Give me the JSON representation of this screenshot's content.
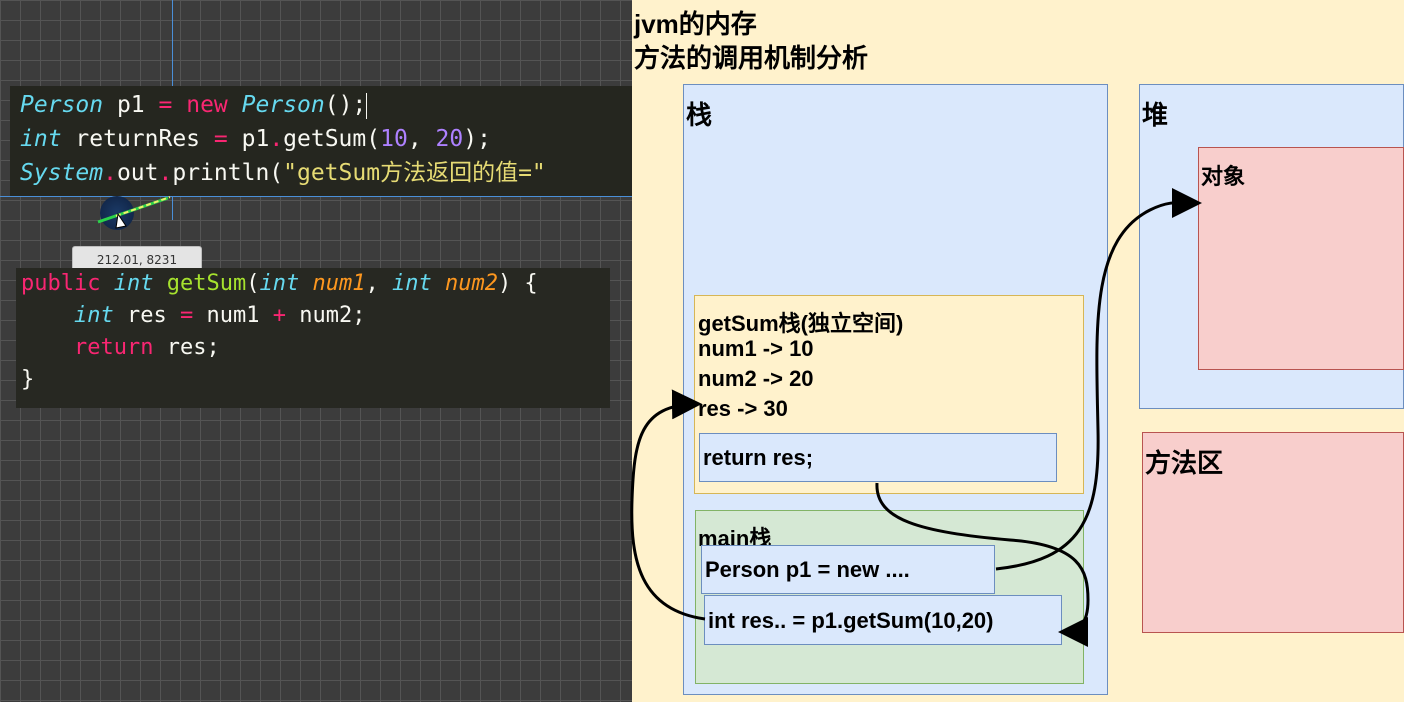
{
  "code1": {
    "line1": {
      "type": "Person",
      "var": "p1",
      "op": "=",
      "kw": "new",
      "ctor": "Person",
      "tail": "();"
    },
    "line2": {
      "type": "int",
      "var": "returnRes",
      "op": "=",
      "obj": "p1",
      "call": "getSum(",
      "n1": "10",
      "sep": ", ",
      "n2": "20",
      "tail": ");"
    },
    "line3": {
      "cls": "System",
      "field": "out",
      "call": "println(",
      "str": "\"getSum方法返回的值=\""
    }
  },
  "code2": {
    "line1": {
      "kw": "public",
      "type": "int",
      "fn": "getSum",
      "open": "(",
      "t1": "int",
      "p1": "num1",
      "sep": ", ",
      "t2": "int",
      "p2": "num2",
      "close": ") {"
    },
    "line2": {
      "type": "int",
      "var": "res",
      "op": "=",
      "a": "num1",
      "plus": "+",
      "b": "num2;"
    },
    "line3": {
      "kw": "return",
      "tail": "res;"
    },
    "line4": {
      "close": "}"
    }
  },
  "tooltip": "212.01, 8231",
  "diagram": {
    "title_line1": "jvm的内存",
    "title_line2": "方法的调用机制分析",
    "stack_label": "栈",
    "heap_label": "堆",
    "object_label": "对象",
    "method_area_label": "方法区",
    "getsum_frame": {
      "title": "getSum栈(独立空间)",
      "line1": "num1 -> 10",
      "line2": "num2 -> 20",
      "line3": "res -> 30",
      "return_stmt": "return res;"
    },
    "main_frame": {
      "title": "main栈",
      "stmt1": "Person p1 = new ....",
      "stmt2": "int res.. = p1.getSum(10,20)"
    }
  },
  "colors": {
    "canvas_bg": "#fff2cc",
    "stack_fill": "#dae8fc",
    "object_fill": "#f8cecc",
    "frame_fill": "#fff2cc",
    "main_fill": "#d5e8d4"
  }
}
